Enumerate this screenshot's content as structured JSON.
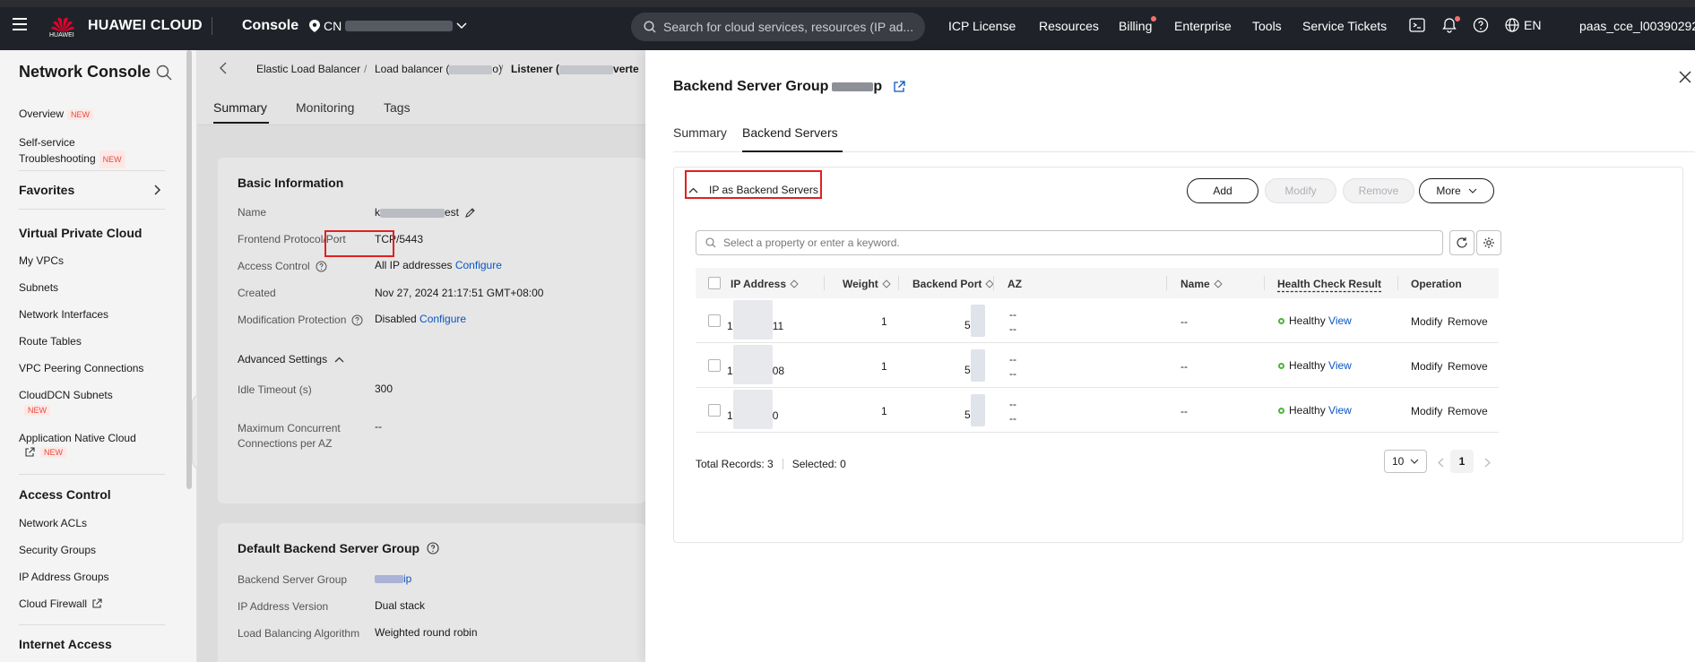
{
  "topbar": {
    "logo_text": "HUAWEI",
    "brand": "HUAWEI CLOUD",
    "console": "Console",
    "region_prefix": "CN",
    "search_placeholder": "Search for cloud services, resources (IP ad...",
    "nav": [
      "ICP License",
      "Resources",
      "Billing",
      "Enterprise",
      "Tools",
      "Service Tickets"
    ],
    "language": "EN",
    "user": "paas_cce_l00390292"
  },
  "sidebar": {
    "title": "Network Console",
    "new_badge": "NEW",
    "overview": "Overview",
    "self_service_line1": "Self-service",
    "self_service_line2": "Troubleshooting",
    "favorites": "Favorites",
    "vpc_heading": "Virtual Private Cloud",
    "vpc_items": [
      "My VPCs",
      "Subnets",
      "Network Interfaces",
      "Route Tables",
      "VPC Peering Connections"
    ],
    "clouddcn": "CloudDCN Subnets",
    "app_native_cloud": "Application Native Cloud",
    "access_heading": "Access Control",
    "access_items": [
      "Network ACLs",
      "Security Groups",
      "IP Address Groups",
      "Cloud Firewall"
    ],
    "internet_heading": "Internet Access"
  },
  "breadcrumb": {
    "elb": "Elastic Load Balancer",
    "lb_prefix": "Load balancer (",
    "lb_suffix": "o)",
    "listener_prefix": "Listener (",
    "listener_suffix": "verte"
  },
  "main_tabs": [
    "Summary",
    "Monitoring",
    "Tags"
  ],
  "basic_info": {
    "title": "Basic Information",
    "labels": {
      "name": "Name",
      "frontend": "Frontend Protocol/Port",
      "access_control": "Access Control",
      "created": "Created",
      "modification": "Modification Protection"
    },
    "name_prefix": "k",
    "name_suffix": "est",
    "frontend_value": "TCP/5443",
    "access_value": "All IP addresses",
    "configure": "Configure",
    "created_value": "Nov 27, 2024 21:17:51 GMT+08:00",
    "modification_value": "Disabled",
    "advanced_settings": "Advanced Settings",
    "idle_timeout_label": "Idle Timeout (s)",
    "idle_timeout_value": "300",
    "max_conn_label_1": "Maximum Concurrent",
    "max_conn_label_2": "Connections per AZ",
    "max_conn_value": "--"
  },
  "default_group": {
    "title": "Default Backend Server Group",
    "bsg_label": "Backend Server Group",
    "bsg_value_suffix": "ip",
    "ipver_label": "IP Address Version",
    "ipver_value": "Dual stack",
    "alg_label": "Load Balancing Algorithm",
    "alg_value": "Weighted round robin"
  },
  "drawer": {
    "title_prefix": "Backend Server Group",
    "title_suffix": "p",
    "tabs": [
      "Summary",
      "Backend Servers"
    ],
    "section_title": "IP as Backend Servers",
    "buttons": {
      "add": "Add",
      "modify": "Modify",
      "remove": "Remove",
      "more": "More"
    },
    "filter_placeholder": "Select a property or enter a keyword.",
    "columns": [
      "IP Address",
      "Weight",
      "Backend Port",
      "AZ",
      "Name",
      "Health Check Result",
      "Operation"
    ],
    "rows": [
      {
        "ip_prefix": "1",
        "ip_suffix": "11",
        "weight": "1",
        "port_prefix": "5",
        "az1": "--",
        "az2": "--",
        "name": "--",
        "health": "Healthy",
        "view": "View",
        "modify": "Modify",
        "remove": "Remove"
      },
      {
        "ip_prefix": "1",
        "ip_suffix": "08",
        "weight": "1",
        "port_prefix": "5",
        "az1": "--",
        "az2": "--",
        "name": "--",
        "health": "Healthy",
        "view": "View",
        "modify": "Modify",
        "remove": "Remove"
      },
      {
        "ip_prefix": "1",
        "ip_suffix": "0",
        "weight": "1",
        "port_prefix": "5",
        "az1": "--",
        "az2": "--",
        "name": "--",
        "health": "Healthy",
        "view": "View",
        "modify": "Modify",
        "remove": "Remove"
      }
    ],
    "total_records": "Total Records: 3",
    "selected": "Selected: 0",
    "page_size": "10",
    "page": "1"
  },
  "colors": {
    "accent": "#0a55c4",
    "healthy": "#4ab536",
    "highlight": "#e02020",
    "topbar": "#1f2329"
  }
}
